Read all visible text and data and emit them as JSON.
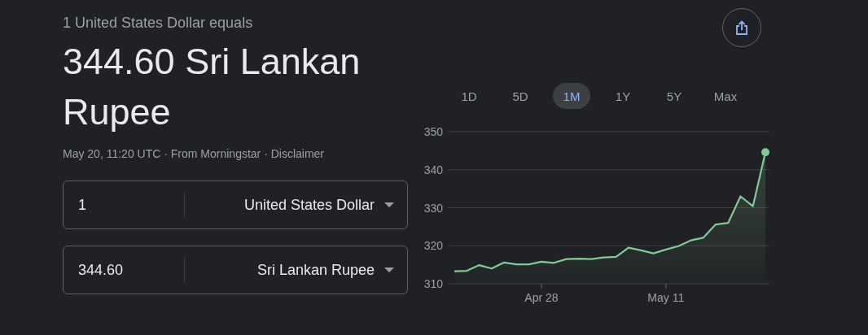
{
  "header": {
    "prefix": "1 United States Dollar equals",
    "result": "344.60 Sri Lankan Rupee",
    "meta": "May 20, 11:20 UTC · From Morningstar · Disclaimer"
  },
  "converters": [
    {
      "amount": "1",
      "currency": "United States Dollar"
    },
    {
      "amount": "344.60",
      "currency": "Sri Lankan Rupee"
    }
  ],
  "ranges": [
    {
      "label": "1D",
      "selected": false
    },
    {
      "label": "5D",
      "selected": false
    },
    {
      "label": "1M",
      "selected": true
    },
    {
      "label": "1Y",
      "selected": false
    },
    {
      "label": "5Y",
      "selected": false
    },
    {
      "label": "Max",
      "selected": false
    }
  ],
  "chart_data": {
    "type": "area",
    "categories": [
      null,
      null,
      null,
      null,
      null,
      null,
      null,
      "Apr 28",
      null,
      null,
      null,
      null,
      null,
      null,
      null,
      null,
      null,
      "May 11",
      null,
      null,
      null,
      null,
      null,
      null,
      null,
      null
    ],
    "series": [
      {
        "color": "#81c995",
        "values": [
          313.3,
          313.4,
          314.9,
          314.0,
          315.6,
          315.1,
          315.1,
          315.8,
          315.5,
          316.5,
          316.6,
          316.5,
          316.9,
          317.1,
          319.5,
          318.8,
          318.0,
          319.0,
          319.9,
          321.4,
          322.1,
          325.6,
          326.0,
          333.0,
          330.4,
          344.6
        ]
      }
    ],
    "ylim": [
      310,
      350
    ],
    "yticks": [
      310,
      320,
      330,
      340,
      350
    ],
    "grid": true
  }
}
